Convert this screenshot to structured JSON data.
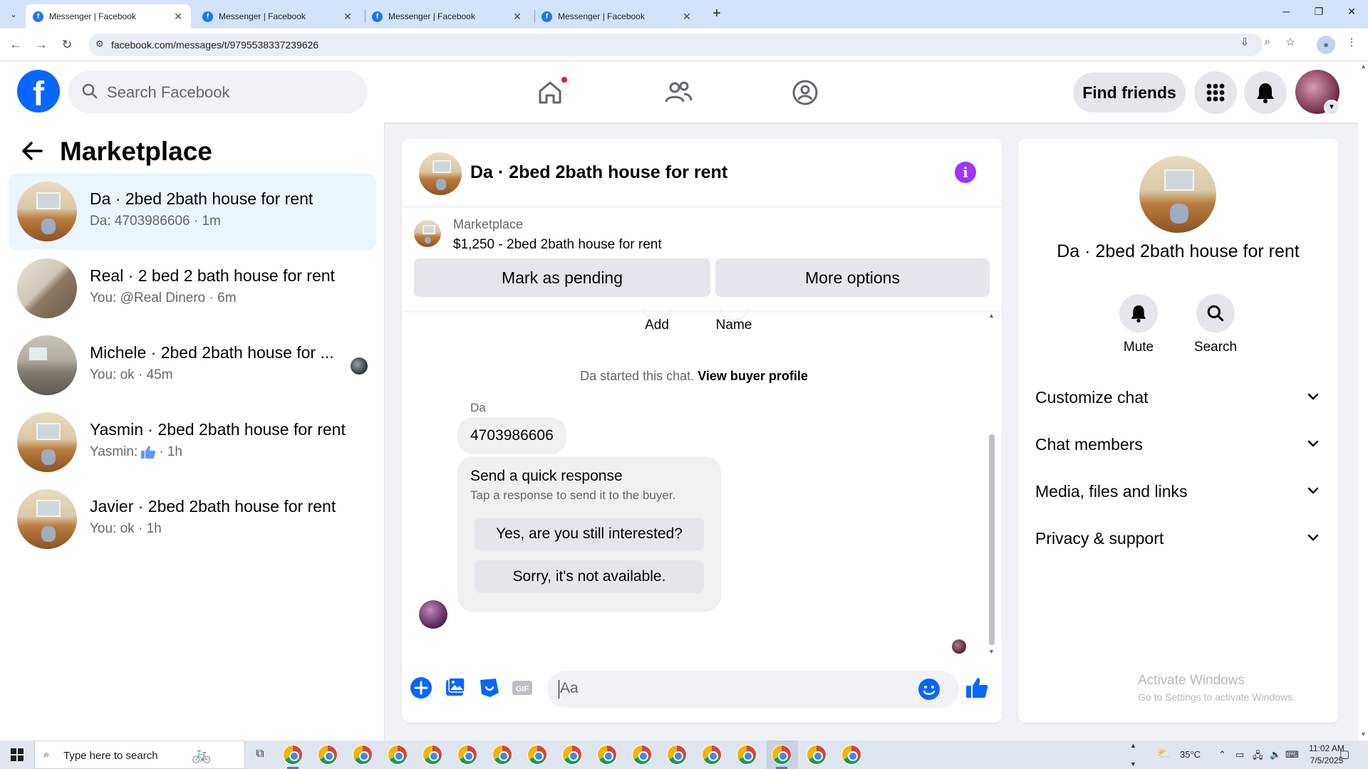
{
  "browser": {
    "tabs": [
      {
        "title": "Messenger | Facebook",
        "active": true
      },
      {
        "title": "Messenger | Facebook",
        "active": false
      },
      {
        "title": "Messenger | Facebook",
        "active": false
      },
      {
        "title": "Messenger | Facebook",
        "active": false
      }
    ],
    "url": "facebook.com/messages/t/9795538337239626"
  },
  "fb": {
    "logo": "f",
    "search_placeholder": "Search Facebook",
    "find_friends": "Find friends"
  },
  "marketplace": {
    "title": "Marketplace",
    "conversations": [
      {
        "title": "Da · 2bed 2bath house for rent",
        "preview": "Da: 4703986606",
        "time": "1m",
        "active": true
      },
      {
        "title": "Real · 2 bed 2 bath house for rent",
        "preview": "You: @Real Dinero",
        "time": "6m"
      },
      {
        "title": "Michele · 2bed 2bath house for ...",
        "preview": "You: ok",
        "time": "45m"
      },
      {
        "title": "Yasmin · 2bed 2bath house for rent",
        "preview": "Yasmin:",
        "time": "1h"
      },
      {
        "title": "Javier · 2bed 2bath house for rent",
        "preview": "You: ok",
        "time": "1h"
      }
    ]
  },
  "chat": {
    "title": "Da · 2bed 2bath house for rent",
    "listing": {
      "label": "Marketplace",
      "title": "$1,250 - 2bed 2bath house for rent",
      "mark_pending": "Mark as pending",
      "more_options": "More options"
    },
    "partial_actions": [
      "Add",
      "Name"
    ],
    "started_text": "Da started this chat.",
    "view_profile": "View buyer profile",
    "sender": "Da",
    "message": "4703986606",
    "quick_response": {
      "title": "Send a quick response",
      "subtitle": "Tap a response to send it to the buyer.",
      "options": [
        "Yes, are you still interested?",
        "Sorry, it's not available."
      ]
    },
    "input_placeholder": "Aa"
  },
  "info": {
    "name": "Da · 2bed 2bath house for rent",
    "actions": [
      "Mute",
      "Search"
    ],
    "sections": [
      "Customize chat",
      "Chat members",
      "Media, files and links",
      "Privacy & support"
    ],
    "watermark_title": "Activate Windows",
    "watermark_sub": "Go to Settings to activate Windows."
  },
  "taskbar": {
    "search_placeholder": "Type here to search",
    "weather": "35°C",
    "time": "11:02 AM",
    "date": "7/5/2025"
  },
  "colors": {
    "fb_blue": "#0866ff",
    "messenger_purple": "#a033ff",
    "active_conv_bg": "#ebf5ff"
  }
}
